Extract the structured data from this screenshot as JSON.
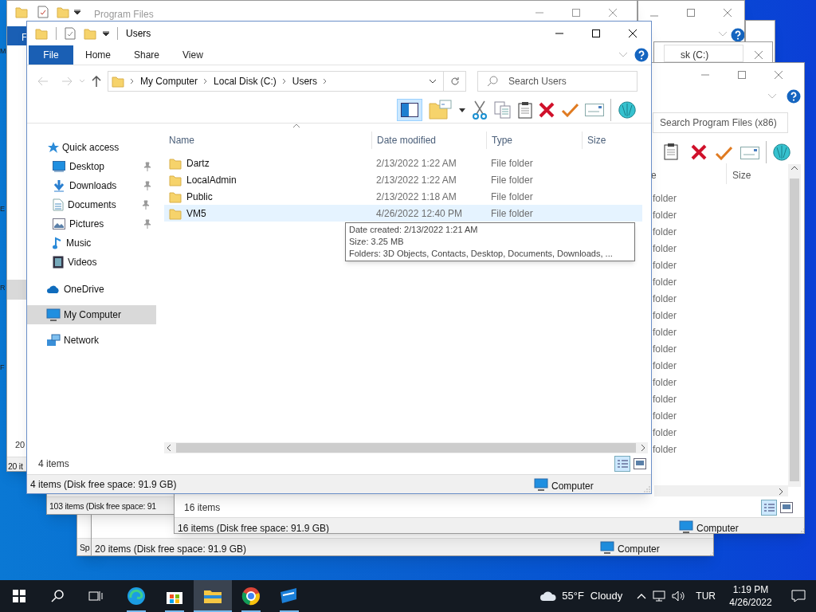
{
  "back_windows": {
    "program_files": {
      "title": "Program Files",
      "tab_fragment": "F",
      "edge_letters": [
        "M",
        "E",
        "R",
        "F"
      ],
      "list_fragment": "20",
      "status": "20 it"
    },
    "address_fragment": "sk (C:)",
    "program_files_x86": {
      "search_placeholder": "Search Program Files (x86)",
      "column_fragment": "e",
      "column_header": "Size",
      "rows": [
        "folder",
        "folder",
        "folder",
        "folder",
        "folder",
        "folder",
        "folder",
        "folder",
        "folder",
        "folder",
        "folder",
        "folder",
        "folder",
        "folder",
        "folder",
        "folder"
      ],
      "list_footer": "16 items",
      "status": "16 items (Disk free space: 91.9 GB)",
      "status_location": "Computer"
    },
    "window_103": {
      "status": "103 items (Disk free space: 91"
    },
    "window_20": {
      "status": "20 items (Disk free space: 91.9 GB)",
      "status_location": "Computer"
    },
    "window_sp": {
      "status": "Sp"
    }
  },
  "window": {
    "title": "Users",
    "ribbon_tabs": [
      {
        "label": "File",
        "selected": true
      },
      {
        "label": "Home",
        "selected": false
      },
      {
        "label": "Share",
        "selected": false
      },
      {
        "label": "View",
        "selected": false
      }
    ],
    "address": [
      "My Computer",
      "Local Disk (C:)",
      "Users"
    ],
    "search": {
      "placeholder": "Search Users"
    },
    "sidebar": [
      {
        "label": "Quick access",
        "selected": false,
        "children": [
          {
            "label": "Desktop",
            "pinned": true
          },
          {
            "label": "Downloads",
            "pinned": true
          },
          {
            "label": "Documents",
            "pinned": true
          },
          {
            "label": "Pictures",
            "pinned": true
          },
          {
            "label": "Music",
            "pinned": false
          },
          {
            "label": "Videos",
            "pinned": false
          }
        ]
      },
      {
        "label": "OneDrive",
        "selected": false
      },
      {
        "label": "My Computer",
        "selected": true
      },
      {
        "label": "Network",
        "selected": false
      }
    ],
    "columns": [
      "Name",
      "Date modified",
      "Type",
      "Size"
    ],
    "rows": [
      {
        "name": "Dartz",
        "date": "2/13/2022 1:22 AM",
        "type": "File folder",
        "selected": false
      },
      {
        "name": "LocalAdmin",
        "date": "2/13/2022 1:22 AM",
        "type": "File folder",
        "selected": false
      },
      {
        "name": "Public",
        "date": "2/13/2022 1:18 AM",
        "type": "File folder",
        "selected": false
      },
      {
        "name": "VM5",
        "date": "4/26/2022 12:40 PM",
        "type": "File folder",
        "selected": true
      }
    ],
    "tooltip": [
      "Date created: 2/13/2022 1:21 AM",
      "Size: 3.25 MB",
      "Folders: 3D Objects, Contacts, Desktop, Documents, Downloads, ..."
    ],
    "list_footer": "4 items",
    "status": "4 items (Disk free space: 91.9 GB)",
    "status_location": "Computer"
  },
  "taskbar": {
    "apps": [
      {
        "active": false
      },
      {
        "active": false
      },
      {
        "active": true
      },
      {
        "active": false
      },
      {
        "active": false
      }
    ],
    "weather": {
      "temperature": "55°F",
      "condition": "Cloudy"
    },
    "language": "TUR",
    "time": "1:19 PM",
    "date": "4/26/2022"
  }
}
